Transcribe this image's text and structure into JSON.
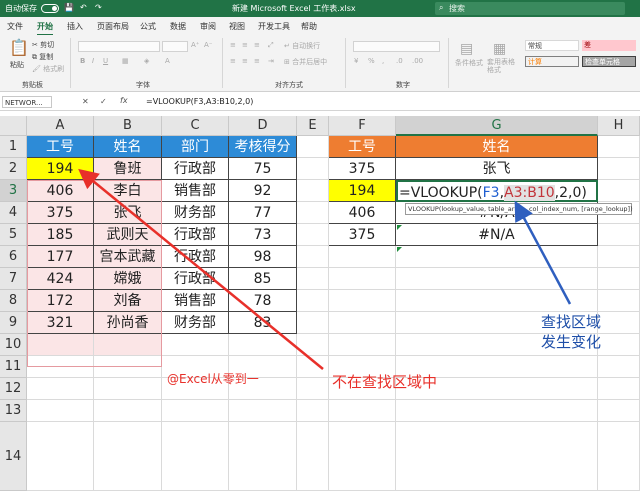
{
  "titlebar": {
    "autosave_label": "自动保存",
    "title": "新建 Microsoft Excel 工作表.xlsx",
    "search_placeholder": "搜索"
  },
  "tabs": [
    "文件",
    "开始",
    "插入",
    "页面布局",
    "公式",
    "数据",
    "审阅",
    "视图",
    "开发工具",
    "帮助"
  ],
  "ribbon": {
    "clipboard": {
      "paste": "粘贴",
      "cut": "剪切",
      "copy": "复制",
      "format_painter": "格式刷",
      "group": "剪贴板"
    },
    "font": {
      "group": "字体"
    },
    "alignment": {
      "wrap": "自动换行",
      "merge": "合并后居中",
      "group": "对齐方式"
    },
    "number": {
      "group": "数字"
    },
    "styles": {
      "conditional": "条件格式",
      "table": "套用表格格式",
      "normal": "常规",
      "bad": "差",
      "calc": "计算",
      "check": "检查单元格"
    }
  },
  "formula_bar": {
    "name_box": "NETWOR...",
    "fx": "fx",
    "formula": "=VLOOKUP(F3,A3:B10,2,0)"
  },
  "columns": [
    "A",
    "B",
    "C",
    "D",
    "E",
    "F",
    "G",
    "H"
  ],
  "rows": [
    "1",
    "2",
    "3",
    "4",
    "5",
    "6",
    "7",
    "8",
    "9",
    "10",
    "11",
    "12",
    "13",
    "14"
  ],
  "table1": {
    "headers": [
      "工号",
      "姓名",
      "部门",
      "考核得分"
    ],
    "rows": [
      [
        "194",
        "鲁班",
        "行政部",
        "75"
      ],
      [
        "406",
        "李白",
        "销售部",
        "92"
      ],
      [
        "375",
        "张飞",
        "财务部",
        "77"
      ],
      [
        "185",
        "武则天",
        "行政部",
        "73"
      ],
      [
        "177",
        "宫本武藏",
        "行政部",
        "98"
      ],
      [
        "424",
        "嫦娥",
        "行政部",
        "85"
      ],
      [
        "172",
        "刘备",
        "销售部",
        "78"
      ],
      [
        "321",
        "孙尚香",
        "财务部",
        "83"
      ]
    ]
  },
  "table2": {
    "headers": [
      "工号",
      "姓名"
    ],
    "rows": [
      [
        "375",
        "张飞"
      ],
      [
        "194",
        ""
      ],
      [
        "406",
        "#N/A"
      ],
      [
        "375",
        "#N/A"
      ]
    ],
    "editing": {
      "prefix": "=VLOOKUP(",
      "arg1": "F3",
      "comma1": ",",
      "arg2": "A3:B10",
      "rest": ",2,0)"
    },
    "tooltip": "VLOOKUP(lookup_value, table_array, col_index_num, [range_lookup])"
  },
  "annotations": {
    "credit": "@Excel从零到一",
    "not_in_range": "不在查找区域中",
    "range_changed_1": "查找区域",
    "range_changed_2": "发生变化"
  },
  "colors": {
    "excel_green": "#217346",
    "header_blue": "#2d8bd7",
    "header_orange": "#ee7d31",
    "highlight_yellow": "#ffff00",
    "range_pink": "#fbe5e6",
    "arrow_red": "#e8302a",
    "arrow_blue": "#2f5fbf",
    "annotation_blue": "#1f4fa8"
  }
}
